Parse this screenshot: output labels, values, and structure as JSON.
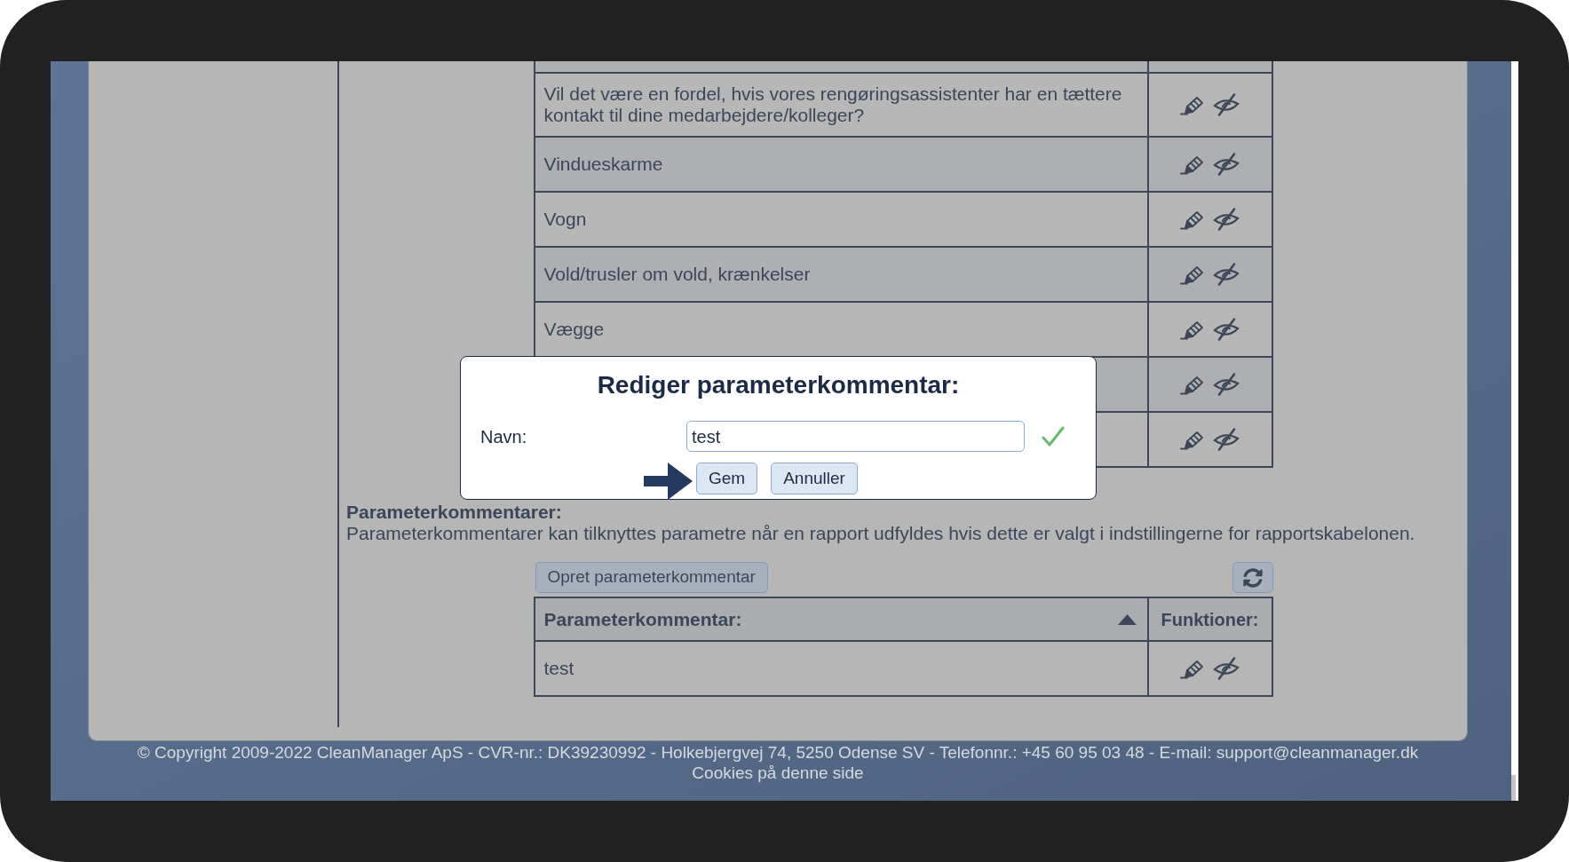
{
  "top_table": {
    "rows": [
      {
        "name": "Vil det være en fordel, hvis vores rengøringsassistenter har en tættere kontakt til dine medarbejdere/kolleger?"
      },
      {
        "name": "Vindueskarme"
      },
      {
        "name": "Vogn"
      },
      {
        "name": "Vold/trusler om vold, krænkelser"
      },
      {
        "name": "Vægge"
      },
      {},
      {}
    ]
  },
  "section": {
    "title": "Parameterkommentarer:",
    "description": "Parameterkommentarer kan tilknyttes parametre når en rapport udfyldes hvis dette er valgt i indstillingerne for rapportskabelonen.",
    "create_button": "Opret parameterkommentar"
  },
  "comments_table": {
    "columns": [
      {
        "label": "Parameterkommentar:",
        "sorted_ascending": true
      },
      {
        "label": "Funktioner:"
      }
    ],
    "rows": [
      {
        "name": "test"
      }
    ]
  },
  "dialog": {
    "title": "Rediger parameterkommentar:",
    "field_label": "Navn:",
    "field_value": "test",
    "valid": true,
    "buttons": [
      "Gem",
      "Annuller"
    ]
  },
  "footer": {
    "copyright": "© Copyright 2009-2022 CleanManager ApS - CVR-nr.: DK39230992 - Holkebjergvej 74, 5250 Odense SV - Telefonnr.: +45 60 95 03 48 - E-mail: support@cleanmanager.dk",
    "link": "Cookies på denne side"
  }
}
